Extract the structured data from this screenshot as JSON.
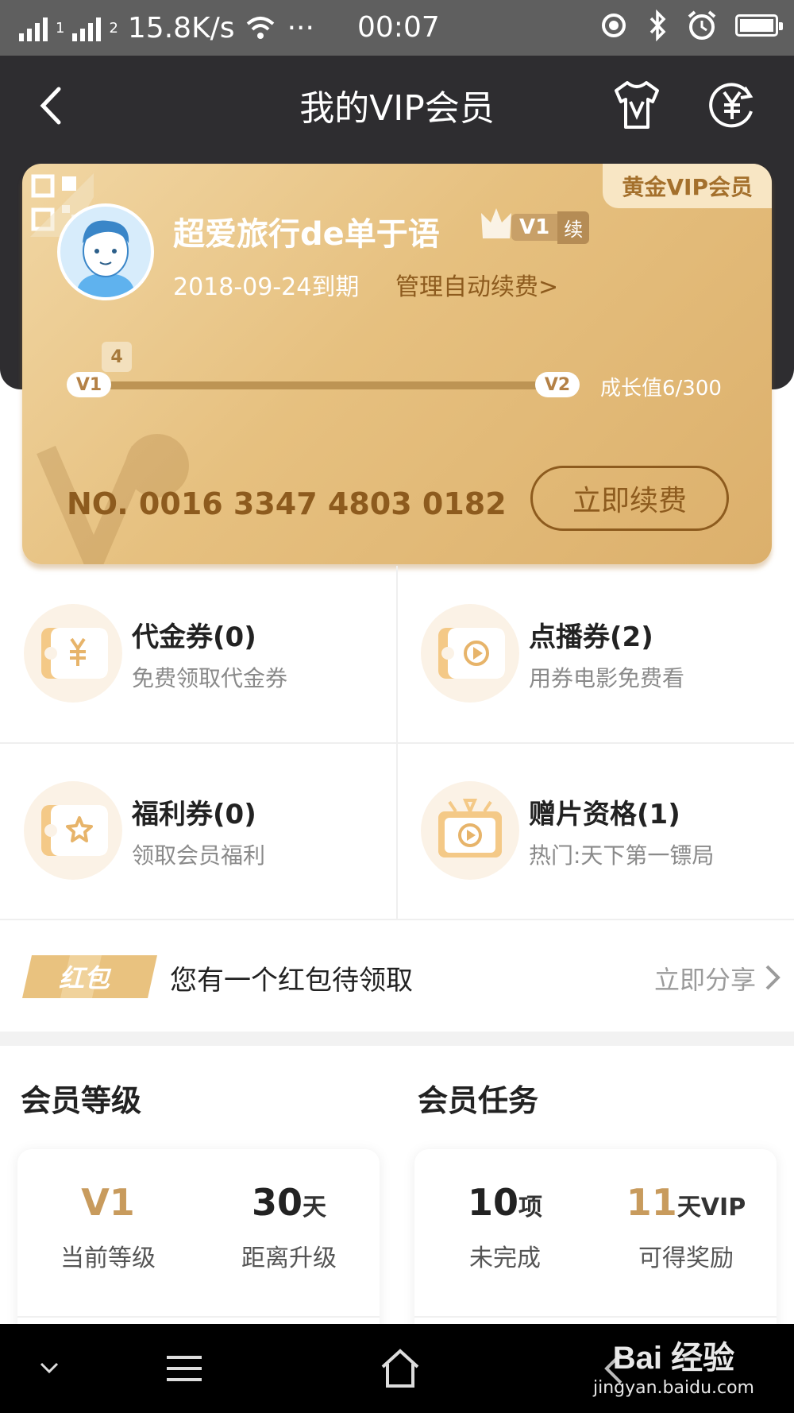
{
  "status_bar": {
    "speed": "15.8K/s",
    "dots": "···",
    "time": "00:07",
    "signal_1": "1",
    "signal_2": "2"
  },
  "header": {
    "title": "我的VIP会员",
    "icons": [
      "back-icon",
      "tshirt-v-icon",
      "yuan-refresh-icon"
    ]
  },
  "card": {
    "badge": "黄金VIP会员",
    "username": "超爱旅行de单于语",
    "level_badge": "V1",
    "renew_mark": "续",
    "expire": "2018-09-24到期",
    "manage_link": "管理自动续费>",
    "progress": {
      "from_level": "V1",
      "to_level": "V2",
      "marker": "4",
      "growth_label": "成长值6/300",
      "fraction": 0.02
    },
    "card_number": "NO. 0016 3347 4803 0182",
    "renew_button": "立即续费",
    "accent": "#8d5b1e"
  },
  "coupons": [
    {
      "title": "代金券(0)",
      "subtitle": "免费领取代金券",
      "icon": "yuan-ticket-icon"
    },
    {
      "title": "点播券(2)",
      "subtitle": "用券电影免费看",
      "icon": "play-ticket-icon"
    },
    {
      "title": "福利券(0)",
      "subtitle": "领取会员福利",
      "icon": "star-ticket-icon"
    },
    {
      "title": "赠片资格(1)",
      "subtitle": "热门:天下第一镖局",
      "icon": "gift-film-icon"
    }
  ],
  "red_packet": {
    "tag": "红包",
    "text": "您有一个红包待领取",
    "action": "立即分享"
  },
  "member_level": {
    "title": "会员等级",
    "current_value": "V1",
    "current_label": "当前等级",
    "days_value": "30",
    "days_unit": "天",
    "days_label": "距离升级"
  },
  "member_tasks": {
    "title": "会员任务",
    "pending_value": "10",
    "pending_unit": "项",
    "pending_label": "未完成",
    "reward_value": "11",
    "reward_unit": "天VIP",
    "reward_label": "可得奖励"
  },
  "watermark": {
    "main": "Bai 经验",
    "sub": "jingyan.baidu.com"
  }
}
